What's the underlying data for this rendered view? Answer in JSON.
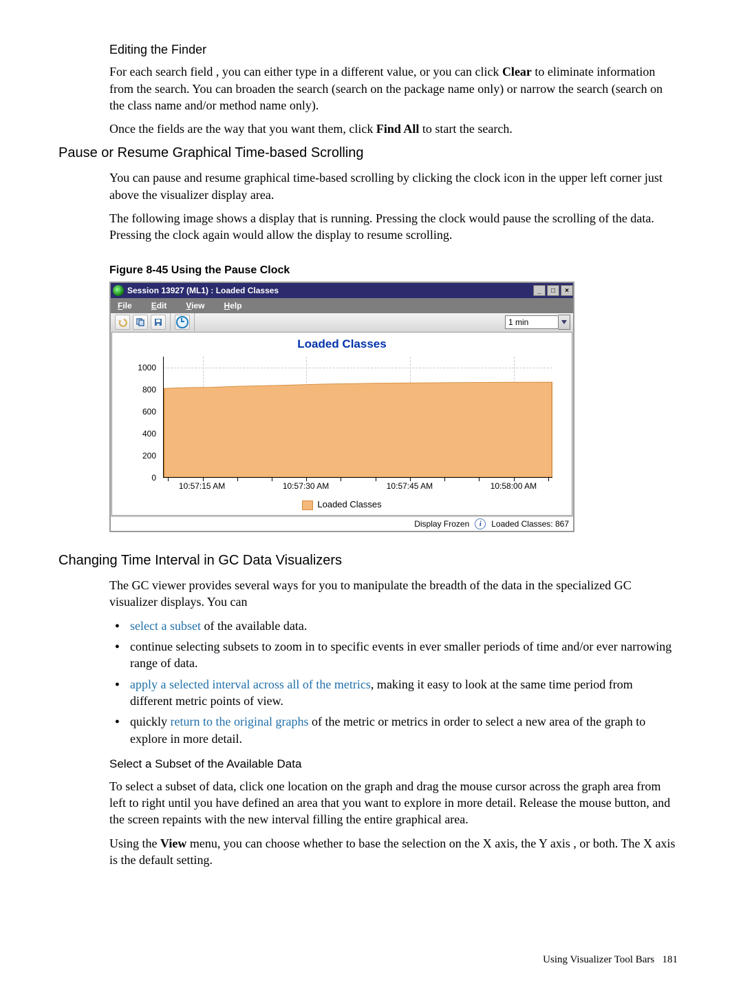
{
  "heading_editing_finder": "Editing the Finder",
  "p1_a": "For each search field , you can either type in a different value, or you can click ",
  "p1_clear": "Clear",
  "p1_b": " to eliminate information from the search. You can broaden the search (search on the package name only) or narrow the search (search on the class name and/or method name only).",
  "p2_a": "Once the fields are the way that you want them, click ",
  "p2_findall": "Find All",
  "p2_b": " to start the search.",
  "heading_pause": "Pause or Resume Graphical Time-based Scrolling",
  "p3": "You can pause and resume graphical time-based scrolling by clicking the clock icon in the upper left corner just above the visualizer display area.",
  "p4": "The following image shows a display that is running. Pressing the clock would pause the scrolling of the data. Pressing the clock again would allow the display to resume scrolling.",
  "figure_caption": "Figure 8-45 Using the Pause Clock",
  "vis": {
    "title": "Session 13927 (ML1) : Loaded Classes",
    "menu_file": "File",
    "menu_edit": "Edit",
    "menu_view": "View",
    "menu_help": "Help",
    "time_value": "1 min",
    "plot_title": "Loaded Classes",
    "legend": "Loaded Classes",
    "status_frozen": "Display Frozen",
    "status_count": "Loaded Classes: 867",
    "win_min": "_",
    "win_max": "□",
    "win_close": "×"
  },
  "chart_data": {
    "type": "area",
    "title": "Loaded Classes",
    "xlabel": "",
    "ylabel": "",
    "ylim": [
      0,
      1100
    ],
    "y_ticks": [
      0,
      200,
      400,
      600,
      800,
      1000
    ],
    "x_ticks": [
      "10:57:15 AM",
      "10:57:30 AM",
      "10:57:45 AM",
      "10:58:00 AM"
    ],
    "series": [
      {
        "name": "Loaded Classes",
        "x_frac": [
          0.0,
          0.04,
          0.08,
          0.12,
          0.2,
          0.3,
          0.4,
          0.55,
          0.73,
          0.9,
          1.0
        ],
        "values": [
          810,
          815,
          818,
          820,
          830,
          838,
          848,
          858,
          862,
          866,
          867
        ]
      }
    ]
  },
  "heading_changing": "Changing Time Interval in GC Data Visualizers",
  "p5": "The GC viewer provides several ways for you to manipulate the breadth of the data in the specialized GC visualizer displays. You can",
  "li1_link": "select a subset",
  "li1_tail": " of the available data.",
  "li2": "continue selecting subsets to zoom in to specific events in ever smaller periods of time and/or ever narrowing range of data.",
  "li3_link": "apply a selected interval across all of the metrics",
  "li3_tail": ", making it easy to look at the same time period from different metric points of view.",
  "li4_a": "quickly ",
  "li4_link": "return to the original graphs",
  "li4_b": " of the metric or metrics in order to select a new area of the graph to explore in more detail.",
  "heading_select_subset": "Select a Subset of the Available Data",
  "p6": "To select a subset of data, click one location on the graph and drag the mouse cursor across the graph area from left to right until you have defined an area that you want to explore in more detail. Release the mouse button, and the screen repaints with the new interval filling the entire graphical area.",
  "p7_a": "Using the ",
  "p7_view": "View",
  "p7_b": " menu, you can choose whether to base the selection on the X axis, the Y axis , or both. The X axis is the default setting.",
  "footer_text": "Using Visualizer Tool Bars",
  "footer_page": "181"
}
